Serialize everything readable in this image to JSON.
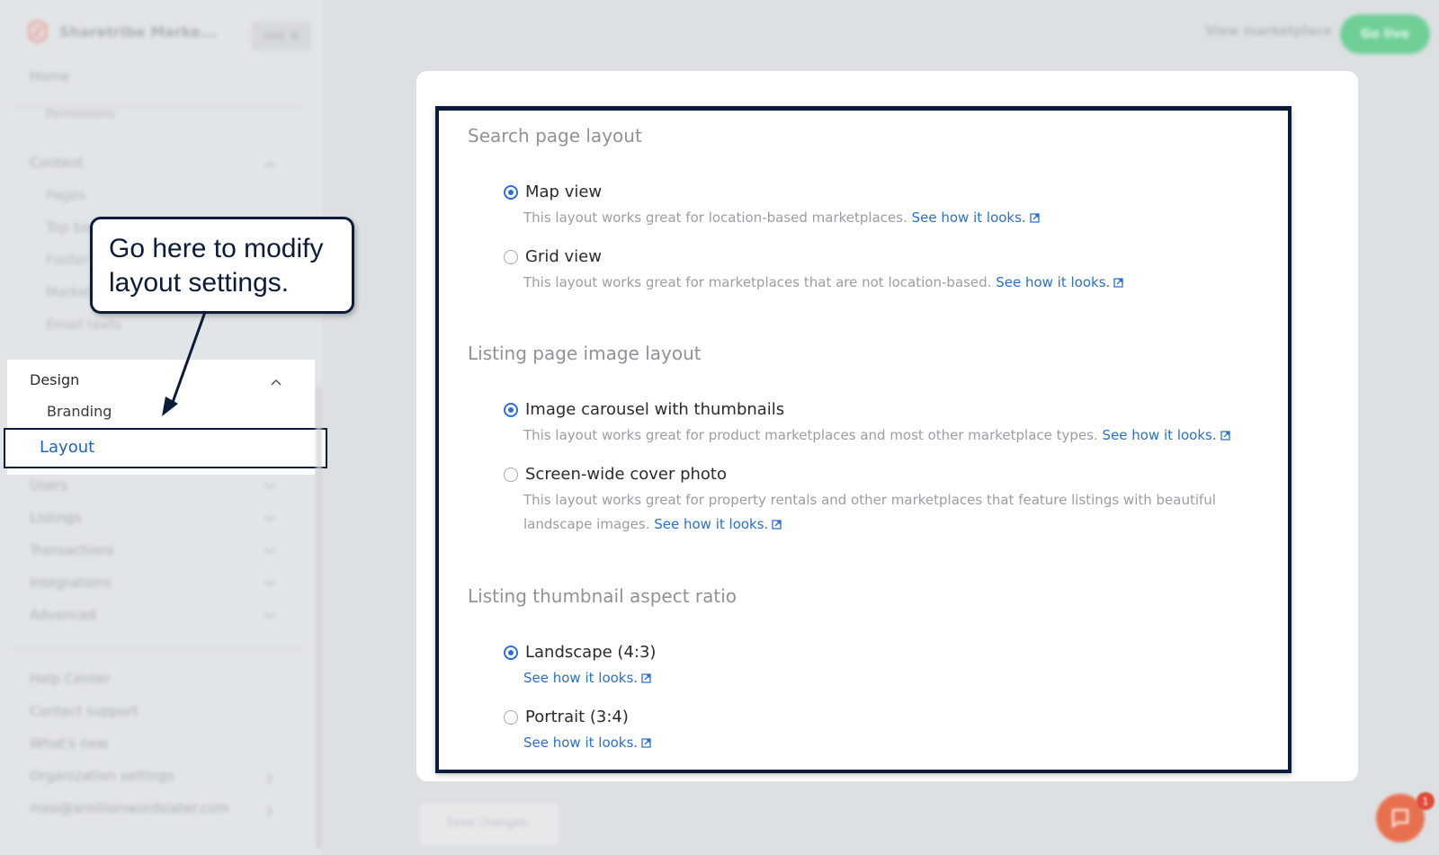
{
  "sidebar": {
    "brand_name": "Sharetribe Marke...",
    "env_badge": "test",
    "home": "Home",
    "permissions": "Permissions",
    "content": {
      "label": "Content",
      "items": [
        "Pages",
        "Top bar",
        "Footer",
        "Marketplace texts",
        "Email texts"
      ]
    },
    "design": {
      "label": "Design",
      "items": [
        "Branding",
        "Layout"
      ]
    },
    "sections": [
      "Users",
      "Listings",
      "Transactions",
      "Integrations",
      "Advanced"
    ],
    "bottom_links": [
      "Help Center",
      "Contact support",
      "What's new",
      "Organization settings",
      "meo@amillionwordslater.com"
    ]
  },
  "callout": {
    "line1": "Go here to modify",
    "line2": "layout settings."
  },
  "header": {
    "view_marketplace": "View marketplace",
    "go_live": "Go live"
  },
  "main": {
    "sections": [
      {
        "title": "Search page layout",
        "options": [
          {
            "label": "Map view",
            "checked": true,
            "desc": "This layout works great for location-based marketplaces.",
            "link": "See how it looks."
          },
          {
            "label": "Grid view",
            "checked": false,
            "desc": "This layout works great for marketplaces that are not location-based.",
            "link": "See how it looks."
          }
        ]
      },
      {
        "title": "Listing page image layout",
        "options": [
          {
            "label": "Image carousel with thumbnails",
            "checked": true,
            "desc": "This layout works great for product marketplaces and most other marketplace types.",
            "link": "See how it looks."
          },
          {
            "label": "Screen-wide cover photo",
            "checked": false,
            "desc": "This layout works great for property rentals and other marketplaces that feature listings with beautiful landscape images.",
            "link": "See how it looks."
          }
        ]
      },
      {
        "title": "Listing thumbnail aspect ratio",
        "options": [
          {
            "label": "Landscape (4:3)",
            "checked": true,
            "desc": "",
            "link": "See how it looks."
          },
          {
            "label": "Portrait (3:4)",
            "checked": false,
            "desc": "",
            "link": "See how it looks."
          }
        ]
      }
    ]
  },
  "footer": {
    "save_label": "Save changes"
  },
  "chat": {
    "badge": "1"
  },
  "colors": {
    "accent": "#2a6fd1",
    "frame": "#0d1b3a",
    "go_live": "#6fcf97",
    "chat": "#e7714f"
  }
}
